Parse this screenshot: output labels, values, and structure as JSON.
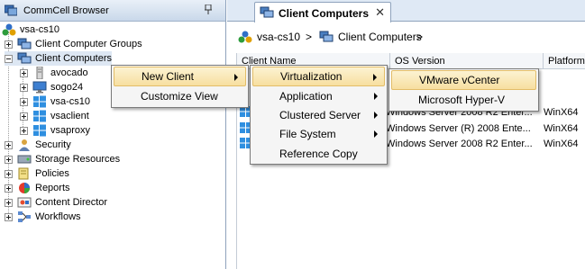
{
  "left_pane": {
    "title": "CommCell Browser",
    "pin_glyph": "ᵖ",
    "tree": {
      "root": "vsa-cs10",
      "client_computer_groups": "Client Computer Groups",
      "client_computers": "Client Computers",
      "clients": [
        "avocado",
        "sogo24",
        "vsa-cs10",
        "vsaclient",
        "vsaproxy"
      ],
      "security": "Security",
      "storage_resources": "Storage Resources",
      "policies": "Policies",
      "reports": "Reports",
      "content_director": "Content Director",
      "workflows": "Workflows"
    }
  },
  "right_pane": {
    "tab_label": "Client Computers",
    "tab_close": "✕",
    "breadcrumb": {
      "root": "vsa-cs10",
      "sep1": ">",
      "current": "Client Computers",
      "sep2": ">"
    },
    "columns": [
      "Client Name",
      "OS Version",
      "Platform"
    ],
    "rows": [
      {
        "os": "Windows Server 2008 R2 Enter...",
        "platform": "WinX64"
      },
      {
        "os": "Windows Server (R) 2008 Ente...",
        "platform": "WinX64"
      },
      {
        "os": "Windows Server 2008 R2 Enter...",
        "platform": "WinX64"
      }
    ]
  },
  "context_menu": {
    "items": [
      "New Client",
      "Customize View"
    ]
  },
  "submenu_new_client": {
    "items": [
      "Virtualization",
      "Application",
      "Clustered Server",
      "File System",
      "Reference Copy"
    ]
  },
  "submenu_virtualization": {
    "items": [
      "VMware vCenter",
      "Microsoft Hyper-V"
    ]
  },
  "colors": {
    "menu_highlight": "#f7dfa0",
    "header_gradient": "#c9d8ea",
    "windows_red": "#f25022",
    "windows_green": "#7fba00",
    "windows_blue": "#00a4ef",
    "windows_yellow": "#ffb900"
  }
}
